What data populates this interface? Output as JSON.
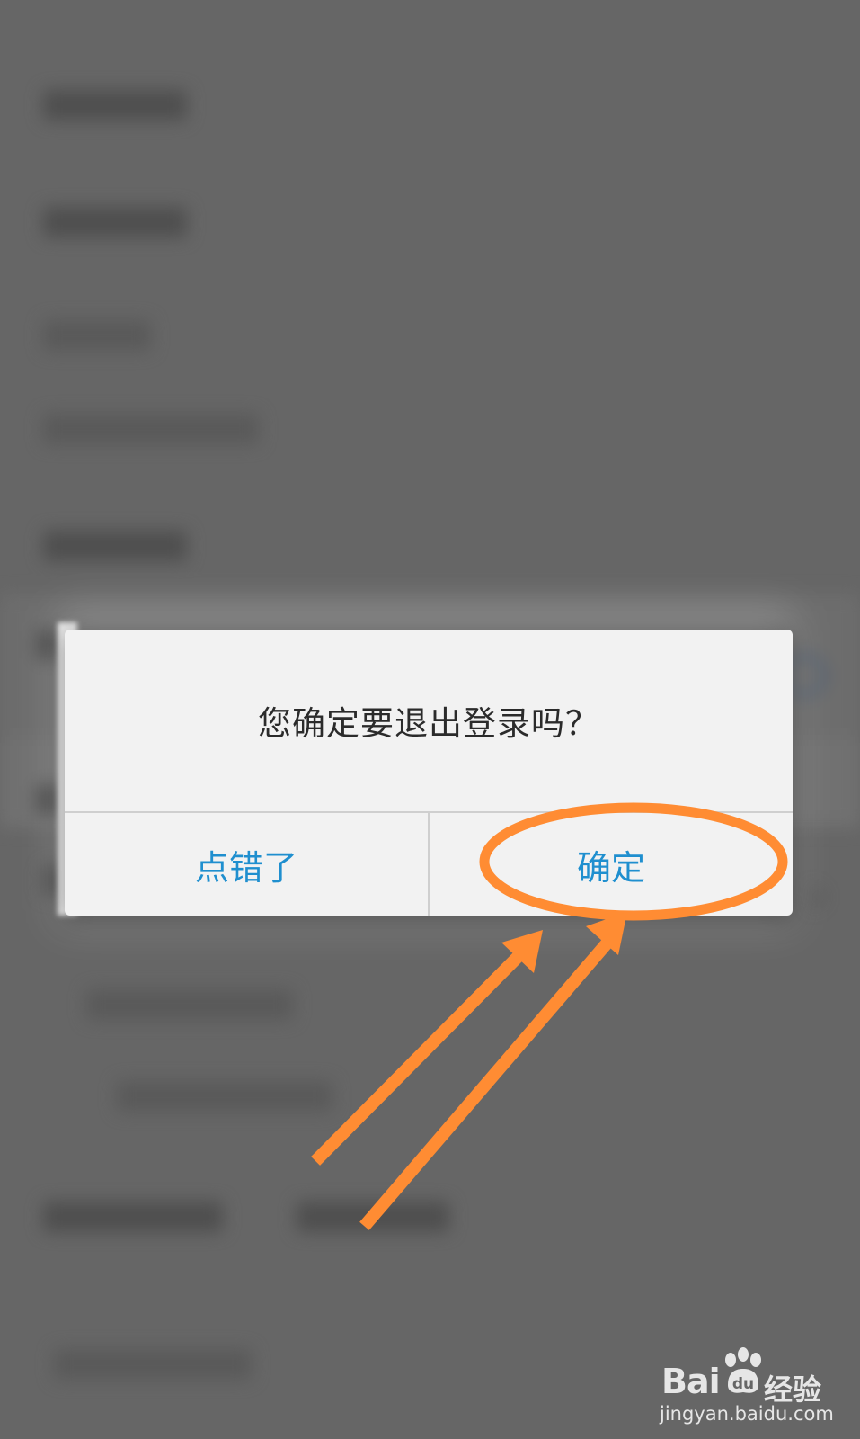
{
  "dialog": {
    "message": "您确定要退出登录吗？",
    "cancel_label": "点错了",
    "confirm_label": "确定"
  },
  "colors": {
    "button_text": "#1f8fcf",
    "annotation": "#ff8c33",
    "overlay": "#666666"
  },
  "watermark": {
    "brand": "Bai",
    "brand_cn": "经验",
    "url": "jingyan.baidu.com"
  },
  "icons": [
    "chevron-right-icon",
    "arrow-icon",
    "highlight-ellipse",
    "baidu-paw-icon"
  ]
}
